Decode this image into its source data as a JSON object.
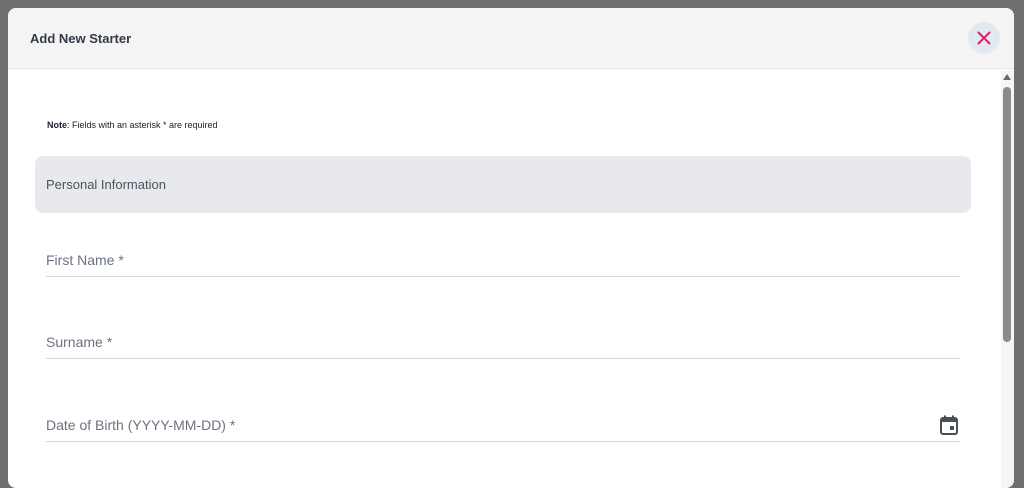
{
  "modal": {
    "title": "Add New Starter",
    "close_icon": "close-icon",
    "accent_color": "#e0245e"
  },
  "note": {
    "label": "Note",
    "text": ": Fields with an asterisk * are required"
  },
  "sections": [
    {
      "title": "Personal Information"
    }
  ],
  "fields": {
    "first_name": {
      "placeholder": "First Name *",
      "value": ""
    },
    "surname": {
      "placeholder": "Surname *",
      "value": ""
    },
    "dob": {
      "placeholder": "Date of Birth (YYYY-MM-DD) *",
      "value": "",
      "icon": "calendar-icon"
    }
  }
}
